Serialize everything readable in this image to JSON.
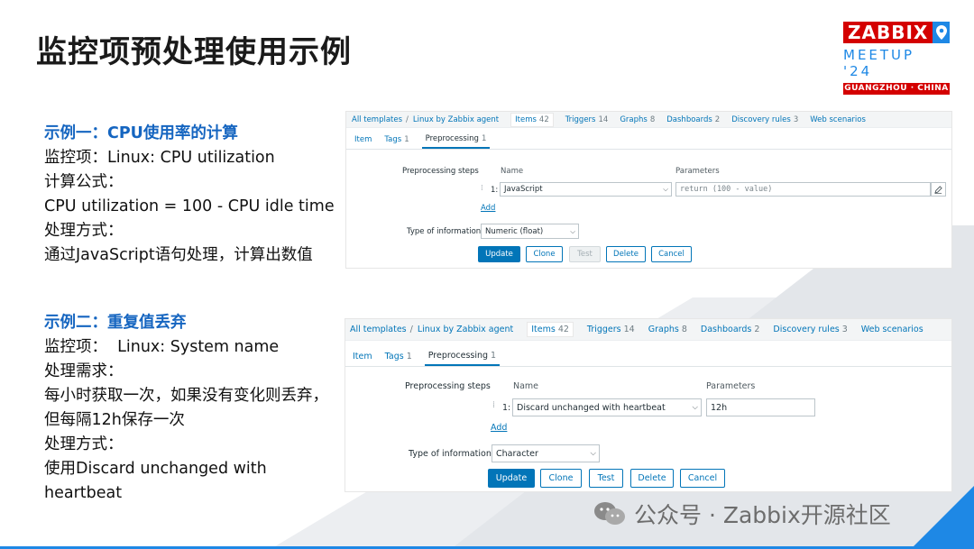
{
  "title": "监控项预处理使用示例",
  "logo": {
    "word": "ZABBIX",
    "meetup": "MEETUP '24",
    "city": "GUANGZHOU · CHINA"
  },
  "example1": {
    "heading": "示例一：CPU使用率的计算",
    "lines": [
      "监控项：Linux: CPU utilization",
      "计算公式：",
      "CPU utilization = 100 - CPU idle time",
      "处理方式：",
      "通过JavaScript语句处理，计算出数值"
    ]
  },
  "example2": {
    "heading": "示例二：重复值丢弃",
    "lines": [
      "监控项：  Linux: System name",
      "处理需求：",
      "每小时获取一次，如果没有变化则丢弃，",
      "但每隔12h保存一次",
      "处理方式：",
      "使用Discard unchanged with",
      "heartbeat"
    ]
  },
  "panel1": {
    "crumbs": [
      {
        "label": "All templates",
        "count": ""
      },
      {
        "label": "Linux by Zabbix agent",
        "count": ""
      },
      {
        "label": "Items",
        "count": "42"
      },
      {
        "label": "Triggers",
        "count": "14"
      },
      {
        "label": "Graphs",
        "count": "8"
      },
      {
        "label": "Dashboards",
        "count": "2"
      },
      {
        "label": "Discovery rules",
        "count": "3"
      },
      {
        "label": "Web scenarios",
        "count": ""
      }
    ],
    "tabs": [
      {
        "label": "Item",
        "count": ""
      },
      {
        "label": "Tags",
        "count": "1"
      },
      {
        "label": "Preprocessing",
        "count": "1"
      }
    ],
    "steps_label": "Preprocessing steps",
    "col_name": "Name",
    "col_params": "Parameters",
    "step_num": "1:",
    "step_type": "JavaScript",
    "step_param": "return (100 - value)",
    "add_label": "Add",
    "type_label": "Type of information",
    "type_value": "Numeric (float)",
    "buttons": {
      "update": "Update",
      "clone": "Clone",
      "test": "Test",
      "delete": "Delete",
      "cancel": "Cancel"
    }
  },
  "panel2": {
    "crumbs": [
      {
        "label": "All templates",
        "count": ""
      },
      {
        "label": "Linux by Zabbix agent",
        "count": ""
      },
      {
        "label": "Items",
        "count": "42"
      },
      {
        "label": "Triggers",
        "count": "14"
      },
      {
        "label": "Graphs",
        "count": "8"
      },
      {
        "label": "Dashboards",
        "count": "2"
      },
      {
        "label": "Discovery rules",
        "count": "3"
      },
      {
        "label": "Web scenarios",
        "count": ""
      }
    ],
    "tabs": [
      {
        "label": "Item",
        "count": ""
      },
      {
        "label": "Tags",
        "count": "1"
      },
      {
        "label": "Preprocessing",
        "count": "1"
      }
    ],
    "steps_label": "Preprocessing steps",
    "col_name": "Name",
    "col_params": "Parameters",
    "step_num": "1:",
    "step_type": "Discard unchanged with heartbeat",
    "step_param": "12h",
    "add_label": "Add",
    "type_label": "Type of information",
    "type_value": "Character",
    "buttons": {
      "update": "Update",
      "clone": "Clone",
      "test": "Test",
      "delete": "Delete",
      "cancel": "Cancel"
    }
  },
  "watermark": "公众号 · Zabbix开源社区",
  "colors": {
    "accent": "#1e88e5",
    "brand_red": "#d40000",
    "heading_blue": "#1565c0",
    "zabbix_link": "#0275b8"
  }
}
